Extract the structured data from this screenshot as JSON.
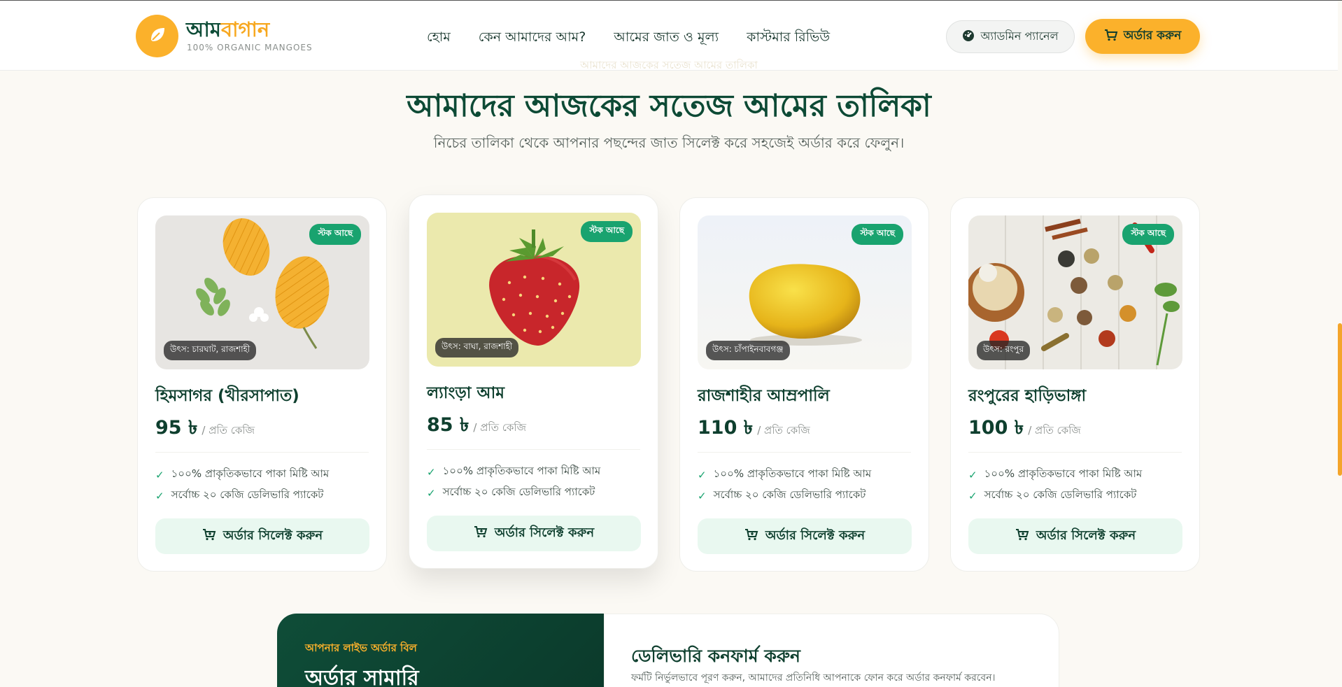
{
  "header": {
    "brand_part1": "আম",
    "brand_part2": "বাগান",
    "tagline": "100% ORGANIC MANGOES",
    "nav": [
      "হোম",
      "কেন আমাদের আম?",
      "আমের জাত ও মূল্য",
      "কাস্টমার রিভিউ"
    ],
    "admin_label": "অ্যাডমিন প্যানেল",
    "order_label": "অর্ডার করুন"
  },
  "section": {
    "faint_text": "আমাদের আজকের সতেজ আমের তালিকা",
    "title": "আমাদের আজকের সতেজ আমের তালিকা",
    "subtitle": "নিচের তালিকা থেকে আপনার পছন্দের জাত সিলেক্ট করে সহজেই অর্ডার করে ফেলুন।"
  },
  "products": [
    {
      "name": "হিমসাগর (খীরসাপাত)",
      "price": "95 ৳",
      "unit": "/ প্রতি কেজি",
      "stock": "স্টক আছে",
      "origin": "উৎস: চারঘাট, রাজশাহী",
      "features": [
        "১০০% প্রাকৃতিকভাবে পাকা মিষ্টি আম",
        "সর্বোচ্চ ২০ কেজি ডেলিভারি প্যাকেট"
      ],
      "button": "অর্ডার সিলেক্ট করুন"
    },
    {
      "name": "ল্যাংড়া আম",
      "price": "85 ৳",
      "unit": "/ প্রতি কেজি",
      "stock": "স্টক আছে",
      "origin": "উৎস: বাঘা, রাজশাহী",
      "features": [
        "১০০% প্রাকৃতিকভাবে পাকা মিষ্টি আম",
        "সর্বোচ্চ ২০ কেজি ডেলিভারি প্যাকেট"
      ],
      "button": "অর্ডার সিলেক্ট করুন"
    },
    {
      "name": "রাজশাহীর আম্রপালি",
      "price": "110 ৳",
      "unit": "/ প্রতি কেজি",
      "stock": "স্টক আছে",
      "origin": "উৎস: চাঁপাইনবাবগঞ্জ",
      "features": [
        "১০০% প্রাকৃতিকভাবে পাকা মিষ্টি আম",
        "সর্বোচ্চ ২০ কেজি ডেলিভারি প্যাকেট"
      ],
      "button": "অর্ডার সিলেক্ট করুন"
    },
    {
      "name": "রংপুরের হাড়িভাঙ্গা",
      "price": "100 ৳",
      "unit": "/ প্রতি কেজি",
      "stock": "স্টক আছে",
      "origin": "উৎস: রংপুর",
      "features": [
        "১০০% প্রাকৃতিকভাবে পাকা মিষ্টি আম",
        "সর্বোচ্চ ২০ কেজি ডেলিভারি প্যাকেট"
      ],
      "button": "অর্ডার সিলেক্ট করুন"
    }
  ],
  "summary": {
    "kicker": "আপনার লাইভ অর্ডার বিল",
    "title": "অর্ডার সামারি"
  },
  "delivery_form": {
    "title": "ডেলিভারি কনফার্ম করুন",
    "subtitle": "ফর্মটি নির্ভুলভাবে পূরণ করুন, আমাদের প্রতিনিধি আপনাকে ফোন করে অর্ডার কনফার্ম করবেন।"
  },
  "icons": {
    "logo": "leaf-icon",
    "admin": "gauge-icon",
    "cart": "cart-icon",
    "cart_add": "cart-plus-icon",
    "check": "check-icon"
  },
  "colors": {
    "brand_green": "#0f4d38",
    "accent_orange": "#fbb12b",
    "stock_green": "#19a36f",
    "button_mint": "#e9f8f0",
    "page_bg": "#fbf9f4"
  }
}
